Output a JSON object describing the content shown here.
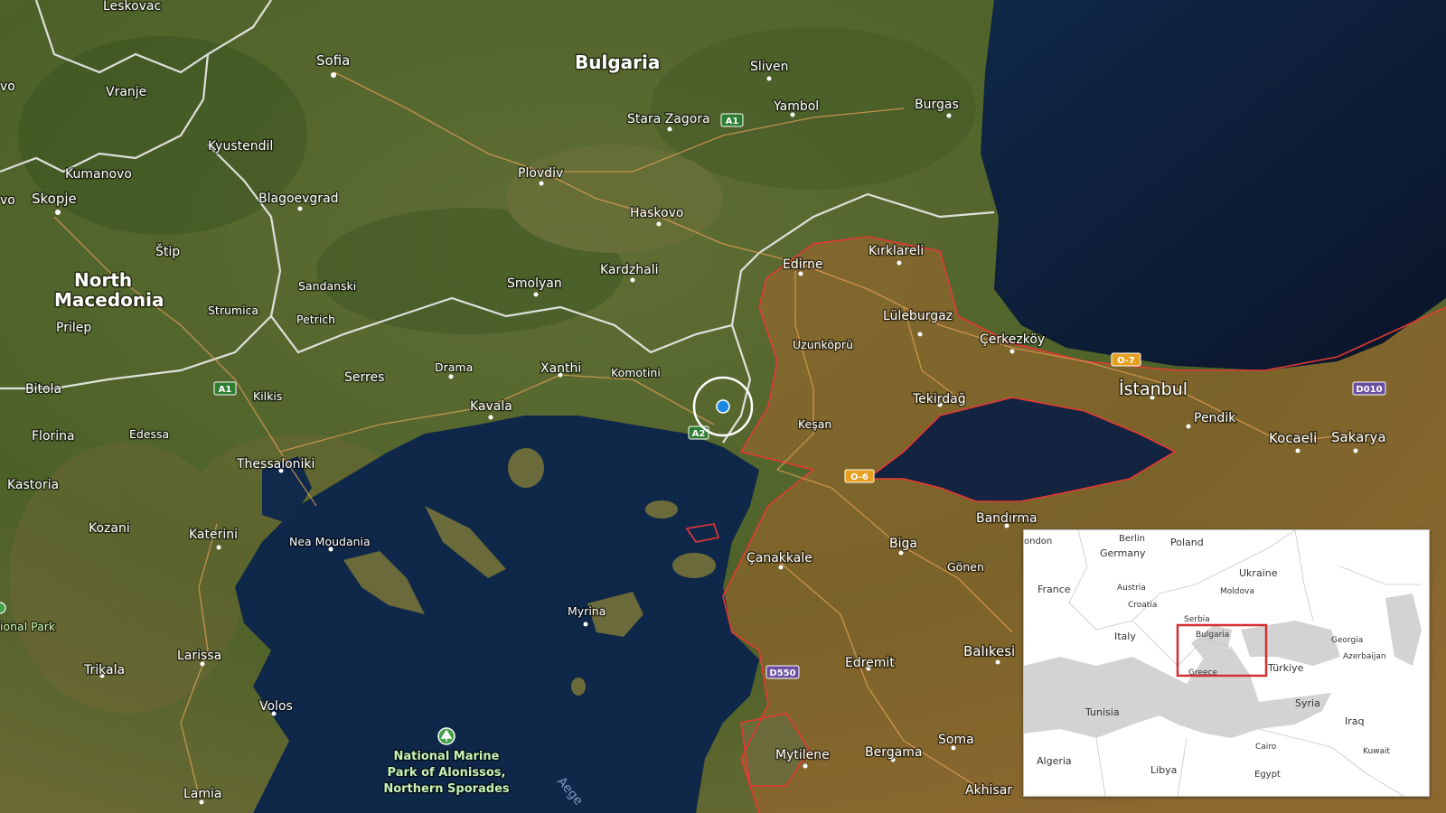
{
  "colors": {
    "land": "#5d6e33",
    "land_dark": "#3e5226",
    "sea": "#0c1f3d",
    "sea_deep": "#0a1529",
    "highlight_border": "#e53935",
    "border": "#ffffff",
    "road": "#e6a15a",
    "location_dot": "#1e88e5",
    "inset_frame": "#d32f2f"
  },
  "map": {
    "countries": {
      "bulgaria": "Bulgaria",
      "north_macedonia_line1": "North",
      "north_macedonia_line2": "Macedonia"
    },
    "cities": {
      "leskovac": "Leskovac",
      "vranje": "Vranje",
      "sofia": "Sofia",
      "sliven": "Sliven",
      "yambol": "Yambol",
      "burgas": "Burgas",
      "stara_zagora": "Stara Zagora",
      "kyustendil": "Kyustendil",
      "kumanovo": "Kumanovo",
      "skopje": "Skopje",
      "plovdiv": "Plovdiv",
      "blagoevgrad": "Blagoevgrad",
      "haskovo": "Haskovo",
      "stip": "Štip",
      "kirklareli": "Kırklareli",
      "edirne": "Edirne",
      "kardzhali": "Kardzhali",
      "smolyan": "Smolyan",
      "sandanski": "Sandanski",
      "strumica": "Strumica",
      "petrich": "Petrich",
      "prilep": "Prilep",
      "luleburgaz": "Lüleburgaz",
      "uzunkopru": "Uzunköprü",
      "cerkezkoy": "Çerkezköy",
      "istanbul": "İstanbul",
      "bitola": "Bitola",
      "kilkis": "Kilkis",
      "serres": "Serres",
      "drama": "Drama",
      "xanthi": "Xanthi",
      "komotini": "Komotini",
      "kavala": "Kavala",
      "tekirdag": "Tekirdağ",
      "pendik": "Pendik",
      "kocaeli": "Kocaeli",
      "sakarya": "Sakarya",
      "florina": "Florina",
      "edessa": "Edessa",
      "kesan": "Keşan",
      "thessaloniki": "Thessaloniki",
      "kastoria": "Kastoria",
      "bandirma": "Bandırma",
      "kozani": "Kozani",
      "katerini": "Katerini",
      "nea_moudania": "Nea Moudania",
      "canakkale": "Çanakkale",
      "biga": "Biga",
      "gonen": "Gönen",
      "myrina": "Myrina",
      "larissa": "Larissa",
      "trikala": "Trikala",
      "edremit": "Edremit",
      "balikesir": "Balıkesi",
      "volos": "Volos",
      "mytilene": "Mytilene",
      "bergama": "Bergama",
      "soma": "Soma",
      "lamia": "Lamia",
      "akhisar": "Akhisar",
      "edge_vo_top": "vo",
      "edge_vo_mid": "vo"
    },
    "parks": {
      "national_park_partial": "ional Park",
      "alonissos_line1": "National Marine",
      "alonissos_line2": "Park of Alonissos,",
      "alonissos_line3": "Northern Sporades"
    },
    "sea_label": "Aege",
    "road_shields": {
      "a1_bulgaria": "A1",
      "a1_greece": "A1",
      "a2_greece": "A2",
      "o7": "O-7",
      "o6": "O-6",
      "d010": "D010",
      "d550": "D550"
    }
  },
  "inset": {
    "labels": {
      "london": "ondon",
      "berlin": "Berlin",
      "poland": "Poland",
      "germany": "Germany",
      "ukraine": "Ukraine",
      "france": "France",
      "austria": "Austria",
      "moldova": "Moldova",
      "croatia": "Croatia",
      "serbia": "Serbia",
      "bulgaria": "Bulgaria",
      "italy": "Italy",
      "georgia": "Georgia",
      "azerbaijan": "Azerbaijan",
      "greece": "Greece",
      "turkiye": "Türkiye",
      "syria": "Syria",
      "tunisia": "Tunisia",
      "iraq": "Iraq",
      "algeria": "Algeria",
      "cairo": "Cairo",
      "kuwait": "Kuwait",
      "libya": "Libya",
      "egypt": "Egypt"
    }
  }
}
